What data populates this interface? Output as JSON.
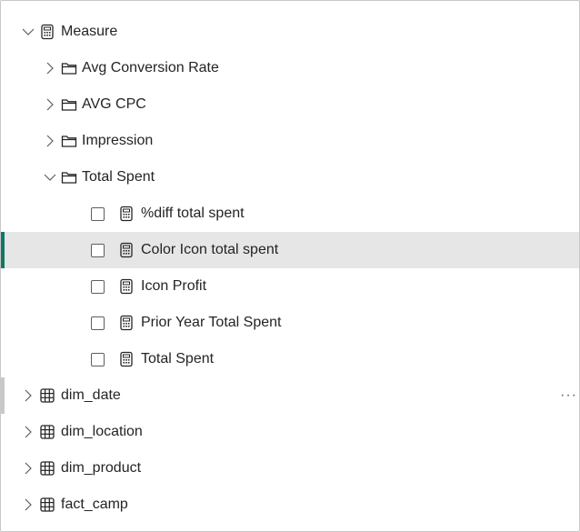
{
  "tree": {
    "measure_group": {
      "label": "Measure",
      "icon": "calculator-icon",
      "expanded": true,
      "folders": [
        {
          "label": "Avg Conversion Rate",
          "icon": "folder-icon",
          "expanded": false
        },
        {
          "label": "AVG CPC",
          "icon": "folder-icon",
          "expanded": false
        },
        {
          "label": "Impression",
          "icon": "folder-icon",
          "expanded": false
        },
        {
          "label": "Total Spent",
          "icon": "folder-icon",
          "expanded": true,
          "measures": [
            {
              "label": "%diff total spent",
              "checked": false
            },
            {
              "label": "Color Icon total spent",
              "checked": false,
              "selected": true
            },
            {
              "label": "Icon Profit",
              "checked": false
            },
            {
              "label": "Prior Year Total Spent",
              "checked": false
            },
            {
              "label": "Total Spent",
              "checked": false
            }
          ]
        }
      ]
    },
    "tables": [
      {
        "label": "dim_date",
        "icon": "table-icon",
        "more": "···"
      },
      {
        "label": "dim_location",
        "icon": "table-icon"
      },
      {
        "label": "dim_product",
        "icon": "table-icon"
      },
      {
        "label": "fact_camp",
        "icon": "table-icon"
      }
    ]
  },
  "colors": {
    "selected_bg": "#e6e6e6",
    "selected_accent": "#117865",
    "hover_accent": "#c8c8c8",
    "text": "#252423"
  }
}
